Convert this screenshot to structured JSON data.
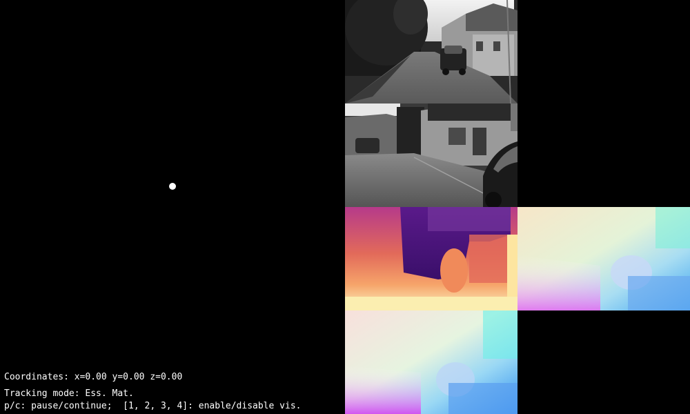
{
  "hud": {
    "coordinates": "Coordinates: x=0.00 y=0.00 z=0.00",
    "tracking_mode": "Tracking mode: Ess. Mat.",
    "help": "p/c: pause/continue;  [1, 2, 3, 4]: enable/disable vis."
  },
  "panels": {
    "trajectory": "trajectory-view",
    "camera_frame_1": "grayscale-frame",
    "camera_frame_2": "grayscale-frame",
    "depth_map": "depth-colormap",
    "flow_map_1": "optical-flow",
    "flow_map_2": "optical-flow"
  },
  "colors": {
    "background": "#000000",
    "text": "#ffffff",
    "trajectory_point": "#ffffff"
  }
}
